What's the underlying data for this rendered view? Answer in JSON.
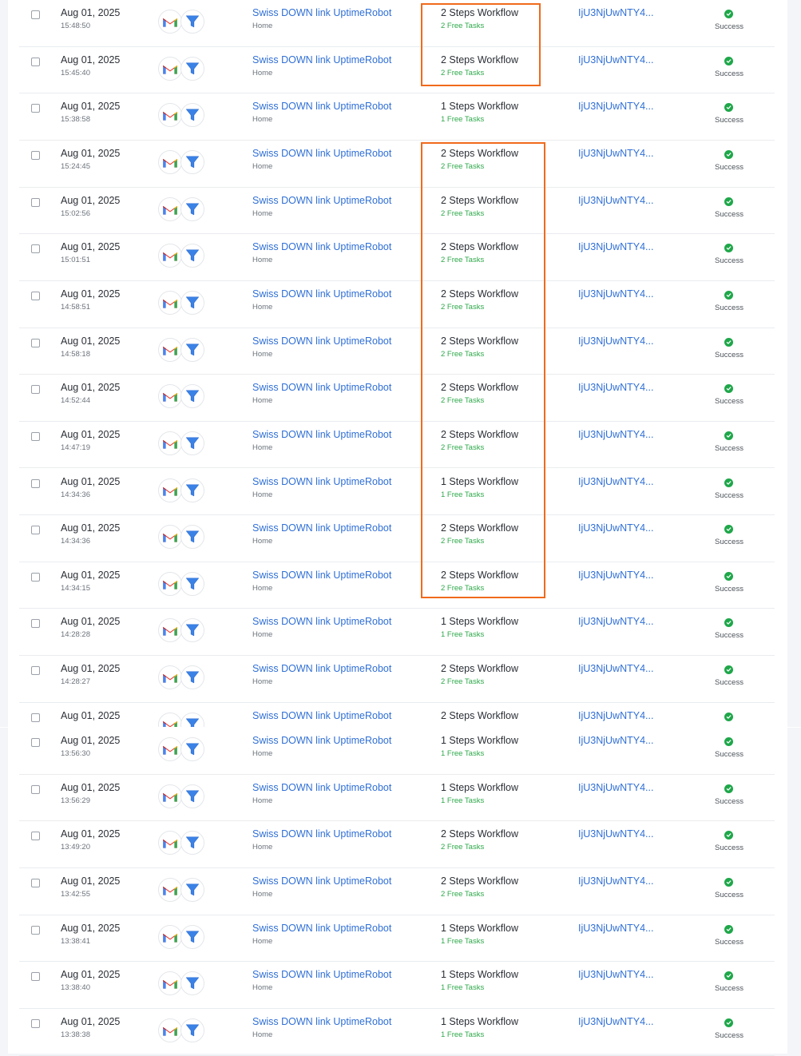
{
  "app_icons": {
    "first": "gmail-icon",
    "second": "filter-icon"
  },
  "colors": {
    "link": "#2f6fd6",
    "tasks": "#2ea84a",
    "success": "#1fa74a",
    "highlight": "#f06a1b"
  },
  "rows_top": [
    {
      "date": "Aug 01, 2025",
      "time": "15:48:50",
      "name": "Swiss DOWN link UptimeRobot",
      "folder": "Home",
      "steps": "2 Steps Workflow",
      "tasks": "2 Free Tasks",
      "run_id": "IjU3NjUwNTY4...",
      "status": "Success"
    },
    {
      "date": "Aug 01, 2025",
      "time": "15:45:40",
      "name": "Swiss DOWN link UptimeRobot",
      "folder": "Home",
      "steps": "2 Steps Workflow",
      "tasks": "2 Free Tasks",
      "run_id": "IjU3NjUwNTY4...",
      "status": "Success"
    },
    {
      "date": "Aug 01, 2025",
      "time": "15:38:58",
      "name": "Swiss DOWN link UptimeRobot",
      "folder": "Home",
      "steps": "1 Steps Workflow",
      "tasks": "1 Free Tasks",
      "run_id": "IjU3NjUwNTY4...",
      "status": "Success"
    },
    {
      "date": "Aug 01, 2025",
      "time": "15:24:45",
      "name": "Swiss DOWN link UptimeRobot",
      "folder": "Home",
      "steps": "2 Steps Workflow",
      "tasks": "2 Free Tasks",
      "run_id": "IjU3NjUwNTY4...",
      "status": "Success"
    },
    {
      "date": "Aug 01, 2025",
      "time": "15:02:56",
      "name": "Swiss DOWN link UptimeRobot",
      "folder": "Home",
      "steps": "2 Steps Workflow",
      "tasks": "2 Free Tasks",
      "run_id": "IjU3NjUwNTY4...",
      "status": "Success"
    },
    {
      "date": "Aug 01, 2025",
      "time": "15:01:51",
      "name": "Swiss DOWN link UptimeRobot",
      "folder": "Home",
      "steps": "2 Steps Workflow",
      "tasks": "2 Free Tasks",
      "run_id": "IjU3NjUwNTY4...",
      "status": "Success"
    },
    {
      "date": "Aug 01, 2025",
      "time": "14:58:51",
      "name": "Swiss DOWN link UptimeRobot",
      "folder": "Home",
      "steps": "2 Steps Workflow",
      "tasks": "2 Free Tasks",
      "run_id": "IjU3NjUwNTY4...",
      "status": "Success"
    },
    {
      "date": "Aug 01, 2025",
      "time": "14:58:18",
      "name": "Swiss DOWN link UptimeRobot",
      "folder": "Home",
      "steps": "2 Steps Workflow",
      "tasks": "2 Free Tasks",
      "run_id": "IjU3NjUwNTY4...",
      "status": "Success"
    },
    {
      "date": "Aug 01, 2025",
      "time": "14:52:44",
      "name": "Swiss DOWN link UptimeRobot",
      "folder": "Home",
      "steps": "2 Steps Workflow",
      "tasks": "2 Free Tasks",
      "run_id": "IjU3NjUwNTY4...",
      "status": "Success"
    },
    {
      "date": "Aug 01, 2025",
      "time": "14:47:19",
      "name": "Swiss DOWN link UptimeRobot",
      "folder": "Home",
      "steps": "2 Steps Workflow",
      "tasks": "2 Free Tasks",
      "run_id": "IjU3NjUwNTY4...",
      "status": "Success"
    },
    {
      "date": "Aug 01, 2025",
      "time": "14:34:36",
      "name": "Swiss DOWN link UptimeRobot",
      "folder": "Home",
      "steps": "1 Steps Workflow",
      "tasks": "1 Free Tasks",
      "run_id": "IjU3NjUwNTY4...",
      "status": "Success"
    },
    {
      "date": "Aug 01, 2025",
      "time": "14:34:36",
      "name": "Swiss DOWN link UptimeRobot",
      "folder": "Home",
      "steps": "2 Steps Workflow",
      "tasks": "2 Free Tasks",
      "run_id": "IjU3NjUwNTY4...",
      "status": "Success"
    },
    {
      "date": "Aug 01, 2025",
      "time": "14:34:15",
      "name": "Swiss DOWN link UptimeRobot",
      "folder": "Home",
      "steps": "2 Steps Workflow",
      "tasks": "2 Free Tasks",
      "run_id": "IjU3NjUwNTY4...",
      "status": "Success"
    },
    {
      "date": "Aug 01, 2025",
      "time": "14:28:28",
      "name": "Swiss DOWN link UptimeRobot",
      "folder": "Home",
      "steps": "1 Steps Workflow",
      "tasks": "1 Free Tasks",
      "run_id": "IjU3NjUwNTY4...",
      "status": "Success"
    },
    {
      "date": "Aug 01, 2025",
      "time": "14:28:27",
      "name": "Swiss DOWN link UptimeRobot",
      "folder": "Home",
      "steps": "2 Steps Workflow",
      "tasks": "2 Free Tasks",
      "run_id": "IjU3NjUwNTY4...",
      "status": "Success"
    },
    {
      "date": "Aug 01, 2025",
      "time": "",
      "name": "Swiss DOWN link UptimeRobot",
      "folder": "",
      "steps": "2 Steps Workflow",
      "tasks": "",
      "run_id": "IjU3NjUwNTY4...",
      "status": ""
    }
  ],
  "rows_bottom": [
    {
      "date": "Aug 01, 2025",
      "time": "13:56:30",
      "name": "Swiss DOWN link UptimeRobot",
      "folder": "Home",
      "steps": "1 Steps Workflow",
      "tasks": "1 Free Tasks",
      "run_id": "IjU3NjUwNTY4...",
      "status": "Success"
    },
    {
      "date": "Aug 01, 2025",
      "time": "13:56:29",
      "name": "Swiss DOWN link UptimeRobot",
      "folder": "Home",
      "steps": "1 Steps Workflow",
      "tasks": "1 Free Tasks",
      "run_id": "IjU3NjUwNTY4...",
      "status": "Success"
    },
    {
      "date": "Aug 01, 2025",
      "time": "13:49:20",
      "name": "Swiss DOWN link UptimeRobot",
      "folder": "Home",
      "steps": "2 Steps Workflow",
      "tasks": "2 Free Tasks",
      "run_id": "IjU3NjUwNTY4...",
      "status": "Success"
    },
    {
      "date": "Aug 01, 2025",
      "time": "13:42:55",
      "name": "Swiss DOWN link UptimeRobot",
      "folder": "Home",
      "steps": "2 Steps Workflow",
      "tasks": "2 Free Tasks",
      "run_id": "IjU3NjUwNTY4...",
      "status": "Success"
    },
    {
      "date": "Aug 01, 2025",
      "time": "13:38:41",
      "name": "Swiss DOWN link UptimeRobot",
      "folder": "Home",
      "steps": "1 Steps Workflow",
      "tasks": "1 Free Tasks",
      "run_id": "IjU3NjUwNTY4...",
      "status": "Success"
    },
    {
      "date": "Aug 01, 2025",
      "time": "13:38:40",
      "name": "Swiss DOWN link UptimeRobot",
      "folder": "Home",
      "steps": "1 Steps Workflow",
      "tasks": "1 Free Tasks",
      "run_id": "IjU3NjUwNTY4...",
      "status": "Success"
    },
    {
      "date": "Aug 01, 2025",
      "time": "13:38:38",
      "name": "Swiss DOWN link UptimeRobot",
      "folder": "Home",
      "steps": "1 Steps Workflow",
      "tasks": "1 Free Tasks",
      "run_id": "IjU3NjUwNTY4...",
      "status": "Success"
    }
  ]
}
